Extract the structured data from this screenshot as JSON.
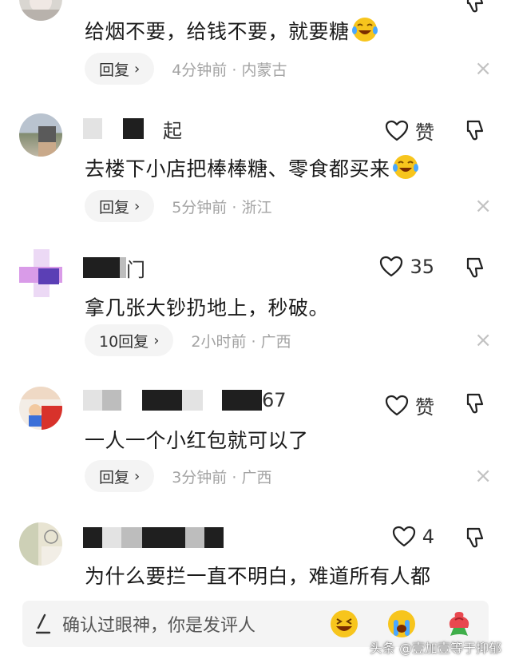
{
  "comments": [
    {
      "username": "",
      "text": "给烟不要，给钱不要，就要糖",
      "likes": "",
      "reply_label": "回复",
      "time": "4分钟前",
      "location": "内蒙古"
    },
    {
      "username": "起",
      "text": "去楼下小店把棒棒糖、零食都买来",
      "likes": "赞",
      "reply_label": "回复",
      "time": "5分钟前",
      "location": "浙江"
    },
    {
      "username": "门",
      "text": "拿几张大钞扔地上，秒破。",
      "likes": "35",
      "reply_label": "10回复",
      "time": "2小时前",
      "location": "广西"
    },
    {
      "username": "67",
      "text": "一人一个小红包就可以了",
      "likes": "赞",
      "reply_label": "回复",
      "time": "3分钟前",
      "location": "广西"
    },
    {
      "username": "",
      "text": "为什么要拦一直不明白，难道所有人都",
      "likes": "4",
      "reply_label": "",
      "time": "",
      "location": ""
    }
  ],
  "separator": " · ",
  "chevron": "›",
  "close_glyph": "×",
  "bottom_bar": {
    "placeholder": "确认过眼神，你是发评人",
    "emojis": [
      "laughing-emoji",
      "crying-emoji",
      "rose-emoji"
    ]
  },
  "watermark": "头条 @壹加壹等于抑郁",
  "colors": {
    "accent_meta": "#a3a3a3",
    "reply_bg": "#f4f4f4",
    "emoji_yellow": "#f7c51d",
    "rose": "#e8484f"
  }
}
